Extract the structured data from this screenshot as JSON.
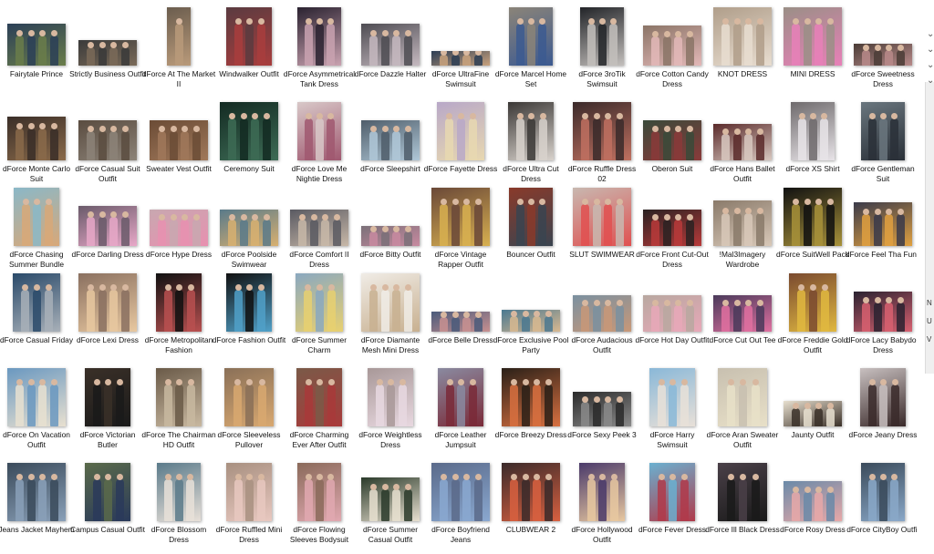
{
  "window": {
    "title": ""
  },
  "right_edge": {
    "chevrons": [
      "chevron-down-icon",
      "chevron-down-icon",
      "chevron-down-icon",
      "chevron-down-icon"
    ],
    "labels": [
      "N",
      "U",
      "V"
    ]
  },
  "items": [
    {
      "label": "Fairytale Prince",
      "colors": [
        "#2b3f57",
        "#6a7d4a"
      ]
    },
    {
      "label": "Strictly Business Outfit",
      "colors": [
        "#3a3a3a",
        "#7a6a58"
      ]
    },
    {
      "label": "dForce At The Market II",
      "colors": [
        "#6b5d4e",
        "#b99a7a"
      ]
    },
    {
      "label": "Windwalker Outfit",
      "colors": [
        "#5a3b40",
        "#a83d3d"
      ]
    },
    {
      "label": "dForce Asymmetrical Tank Dress",
      "colors": [
        "#2a2230",
        "#c9a2b0"
      ]
    },
    {
      "label": "dForce Dazzle Halter",
      "colors": [
        "#4e4c52",
        "#c5b9c0"
      ]
    },
    {
      "label": "dForce UltraFine Swimsuit",
      "colors": [
        "#2c3d53",
        "#c9a27d"
      ]
    },
    {
      "label": "dForce Marcel Home Set",
      "colors": [
        "#8b8478",
        "#3c5a91"
      ]
    },
    {
      "label": "dForce 3roTik Swimsuit",
      "colors": [
        "#222428",
        "#c3bfbc"
      ]
    },
    {
      "label": "dForce Cotton Candy Dress",
      "colors": [
        "#8a7466",
        "#e3b8b8"
      ]
    },
    {
      "label": "KNOT DRESS",
      "colors": [
        "#b09e8a",
        "#e8ddd0"
      ]
    },
    {
      "label": "MINI DRESS",
      "colors": [
        "#9a8f86",
        "#e880b8"
      ]
    },
    {
      "label": "dForce Sweetness Dress",
      "colors": [
        "#4a3c36",
        "#b88a8a"
      ]
    },
    {
      "label": "dForce Monte Carlo Suit",
      "colors": [
        "#3a2e28",
        "#8a6a4a"
      ]
    },
    {
      "label": "dForce Casual Suit Outfit",
      "colors": [
        "#5a4c40",
        "#8c8378"
      ]
    },
    {
      "label": "Sweater Vest Outfit",
      "colors": [
        "#6b4c36",
        "#a0785a"
      ]
    },
    {
      "label": "Ceremony Suit",
      "colors": [
        "#132a22",
        "#3d6b55"
      ]
    },
    {
      "label": "dForce Love Me Nightie Dress",
      "colors": [
        "#d8c8c8",
        "#a05870"
      ]
    },
    {
      "label": "dForce Sleepshirt",
      "colors": [
        "#4f5d6a",
        "#b0c8d8"
      ]
    },
    {
      "label": "dForce Fayette Dress",
      "colors": [
        "#b8a8c8",
        "#e8d8b0"
      ]
    },
    {
      "label": "dForce Ultra Cut Dress",
      "colors": [
        "#3b3836",
        "#d8d2cc"
      ]
    },
    {
      "label": "dForce Ruffle Dress 02",
      "colors": [
        "#3a2a2a",
        "#c07060"
      ]
    },
    {
      "label": "Oberon Suit",
      "colors": [
        "#3a4a3a",
        "#8a3a3a"
      ]
    },
    {
      "label": "dForce Hans Ballet Outfit",
      "colors": [
        "#5a2a2a",
        "#d8c8c0"
      ]
    },
    {
      "label": "dForce XS Shirt",
      "colors": [
        "#6e6a6c",
        "#e8e4e8"
      ]
    },
    {
      "label": "dForce Gentleman Suit",
      "colors": [
        "#6a767e",
        "#2a3038"
      ]
    },
    {
      "label": "dForce Chasing Summer Bundle",
      "colors": [
        "#8ab8c8",
        "#d8a878"
      ]
    },
    {
      "label": "dForce Darling Dress",
      "colors": [
        "#6a5a6a",
        "#e8a8c8"
      ]
    },
    {
      "label": "dForce Hype Dress",
      "colors": [
        "#c8a8b0",
        "#e890b0"
      ]
    },
    {
      "label": "dForce Poolside Swimwear",
      "colors": [
        "#5a7a8a",
        "#d8b070"
      ]
    },
    {
      "label": "dForce Comfort II Dress",
      "colors": [
        "#5a5a62",
        "#c8b8a8"
      ]
    },
    {
      "label": "dForce Bitty Outfit",
      "colors": [
        "#7a7078",
        "#c88aa0"
      ]
    },
    {
      "label": "dForce Vintage Rapper Outfit",
      "colors": [
        "#6a4838",
        "#d8b050"
      ]
    },
    {
      "label": "Bouncer Outfit",
      "colors": [
        "#8a3a2a",
        "#3a4450"
      ]
    },
    {
      "label": "SLUT SWIMWEAR",
      "colors": [
        "#c8b8b0",
        "#e05050"
      ]
    },
    {
      "label": "dForce Front Cut-Out Dress",
      "colors": [
        "#2a2222",
        "#b83a3a"
      ]
    },
    {
      "label": "!Mal3Imagery Wardrobe",
      "colors": [
        "#8a7a6a",
        "#d8c8b8"
      ]
    },
    {
      "label": "dForce SuitWell Pack",
      "colors": [
        "#111111",
        "#a8923a"
      ]
    },
    {
      "label": "dForce Feel Tha Funk",
      "colors": [
        "#3a3a4a",
        "#e0a040"
      ]
    },
    {
      "label": "dForce Casual Friday",
      "colors": [
        "#2a4a6a",
        "#a8b0b8"
      ]
    },
    {
      "label": "dForce Lexi Dress",
      "colors": [
        "#8a7060",
        "#e8c8a0"
      ]
    },
    {
      "label": "dForce Metropolitan Fashion",
      "colors": [
        "#111111",
        "#b85050"
      ]
    },
    {
      "label": "dForce Fashion Outfit",
      "colors": [
        "#111111",
        "#50a0c8"
      ]
    },
    {
      "label": "dForce Summer Charm",
      "colors": [
        "#8aa8c0",
        "#e8d070"
      ]
    },
    {
      "label": "dForce Diamante Mesh Mini Dress",
      "colors": [
        "#f0ece6",
        "#c8b090"
      ]
    },
    {
      "label": "dForce Belle Dress",
      "colors": [
        "#4a5a7a",
        "#c89090"
      ]
    },
    {
      "label": "dForce Exclusive Pool Party",
      "colors": [
        "#4a7890",
        "#d8b890"
      ]
    },
    {
      "label": "dForce Audacious Outfit",
      "colors": [
        "#7a90a0",
        "#c89878"
      ]
    },
    {
      "label": "dForce Hot Day Outfit",
      "colors": [
        "#b8a8a0",
        "#e8a8b8"
      ]
    },
    {
      "label": "dForce Cut Out Tee",
      "colors": [
        "#4a3a5a",
        "#e070a0"
      ]
    },
    {
      "label": "dForce Freddie Gold Outfit",
      "colors": [
        "#7a4a30",
        "#e0b840"
      ]
    },
    {
      "label": "dForce Lacy Babydoll Dress",
      "colors": [
        "#2a2230",
        "#d86070"
      ]
    },
    {
      "label": "dForce On Vacation Outfit",
      "colors": [
        "#6a98c0",
        "#e8e0d0"
      ]
    },
    {
      "label": "dForce Victorian Butler",
      "colors": [
        "#3a3028",
        "#1a1a1a"
      ]
    },
    {
      "label": "dForce The Chairman HD Outfit",
      "colors": [
        "#6a5a48",
        "#c8b8a0"
      ]
    },
    {
      "label": "dForce Sleeveless Pullover",
      "colors": [
        "#8a7058",
        "#d8a870"
      ]
    },
    {
      "label": "dForce Charming Ever After Outfit",
      "colors": [
        "#7a5a48",
        "#a83a3a"
      ]
    },
    {
      "label": "dForce Weightless Dress",
      "colors": [
        "#a89898",
        "#e8d8e0"
      ]
    },
    {
      "label": "dForce Leather Jumpsuit",
      "colors": [
        "#8a8aa0",
        "#7a2a38"
      ]
    },
    {
      "label": "dForce Breezy Dress",
      "colors": [
        "#2a2018",
        "#d87040"
      ]
    },
    {
      "label": "dForce Sexy Peek 3",
      "colors": [
        "#2a2a2a",
        "#8a8a8a"
      ]
    },
    {
      "label": "dForce Harry Swimsuit",
      "colors": [
        "#8ab8d8",
        "#e8e0d8"
      ]
    },
    {
      "label": "dForce Aran Sweater Outfit",
      "colors": [
        "#c8c0b0",
        "#e8e0c8"
      ]
    },
    {
      "label": "Jaunty Outfit",
      "colors": [
        "#e8e0d0",
        "#3a3028"
      ]
    },
    {
      "label": "dForce Jeany Dress",
      "colors": [
        "#c8c0c0",
        "#3a2a2a"
      ]
    },
    {
      "label": "Jeans Jacket Mayhem",
      "colors": [
        "#3a4a5a",
        "#8aa0b8"
      ]
    },
    {
      "label": "Campus Casual Outfit",
      "colors": [
        "#5a6a4a",
        "#2a3a5a"
      ]
    },
    {
      "label": "dForce Blossom Dress",
      "colors": [
        "#5a7a8a",
        "#e8e0d8"
      ]
    },
    {
      "label": "dForce Ruffled Mini Dress",
      "colors": [
        "#a89080",
        "#e8c8c0"
      ]
    },
    {
      "label": "dForce Flowing Sleeves Bodysuit",
      "colors": [
        "#8a6a5a",
        "#e0a8b0"
      ]
    },
    {
      "label": "dForce Summer Casual Outfit",
      "colors": [
        "#2a3a2a",
        "#e8e0d0"
      ]
    },
    {
      "label": "dForce Boyfriend Jeans",
      "colors": [
        "#5a6a8a",
        "#8aa8d0"
      ]
    },
    {
      "label": "CLUBWEAR 2",
      "colors": [
        "#3a2a2a",
        "#d86040"
      ]
    },
    {
      "label": "dForce Hollywood Outfit",
      "colors": [
        "#4a3a6a",
        "#e8c8a0"
      ]
    },
    {
      "label": "dForce Fever Dress",
      "colors": [
        "#6ab0d0",
        "#b03a4a"
      ]
    },
    {
      "label": "dForce Ill Black Dress",
      "colors": [
        "#4a4048",
        "#1a1a1a"
      ]
    },
    {
      "label": "dForce Rosy Dress",
      "colors": [
        "#6a8aa8",
        "#e8a8a8"
      ]
    },
    {
      "label": "dForce CityBoy Outfit",
      "colors": [
        "#3a4a5a",
        "#8aa8c8"
      ]
    }
  ]
}
